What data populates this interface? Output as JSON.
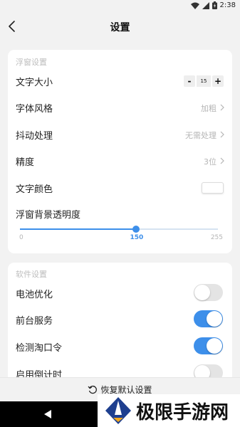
{
  "status": {
    "time": "2:38"
  },
  "header": {
    "title": "设置"
  },
  "float_section": {
    "title": "浮窗设置",
    "font_size": {
      "label": "文字大小",
      "minus": "-",
      "value": "15",
      "plus": "+"
    },
    "font_style": {
      "label": "字体风格",
      "value": "加粗"
    },
    "jitter": {
      "label": "抖动处理",
      "value": "无需处理"
    },
    "precision": {
      "label": "精度",
      "value": "3位"
    },
    "text_color": {
      "label": "文字颜色",
      "color": "#ffffff"
    },
    "bg_opacity": {
      "label": "浮窗背景透明度",
      "min": "0",
      "value": "150",
      "max": "255",
      "fraction": 0.588
    }
  },
  "software_section": {
    "title": "软件设置",
    "battery": {
      "label": "电池优化",
      "on": false
    },
    "foreground": {
      "label": "前台服务",
      "on": true
    },
    "taokouling": {
      "label": "检测淘口令",
      "on": true
    },
    "countdown": {
      "label": "启用倒计时",
      "on": false
    }
  },
  "footer": {
    "reset_label": "恢复默认设置"
  },
  "watermark": {
    "text": "极限手游网"
  },
  "colors": {
    "accent": "#3d8fea",
    "toggle_off": "#e4e4e4"
  }
}
